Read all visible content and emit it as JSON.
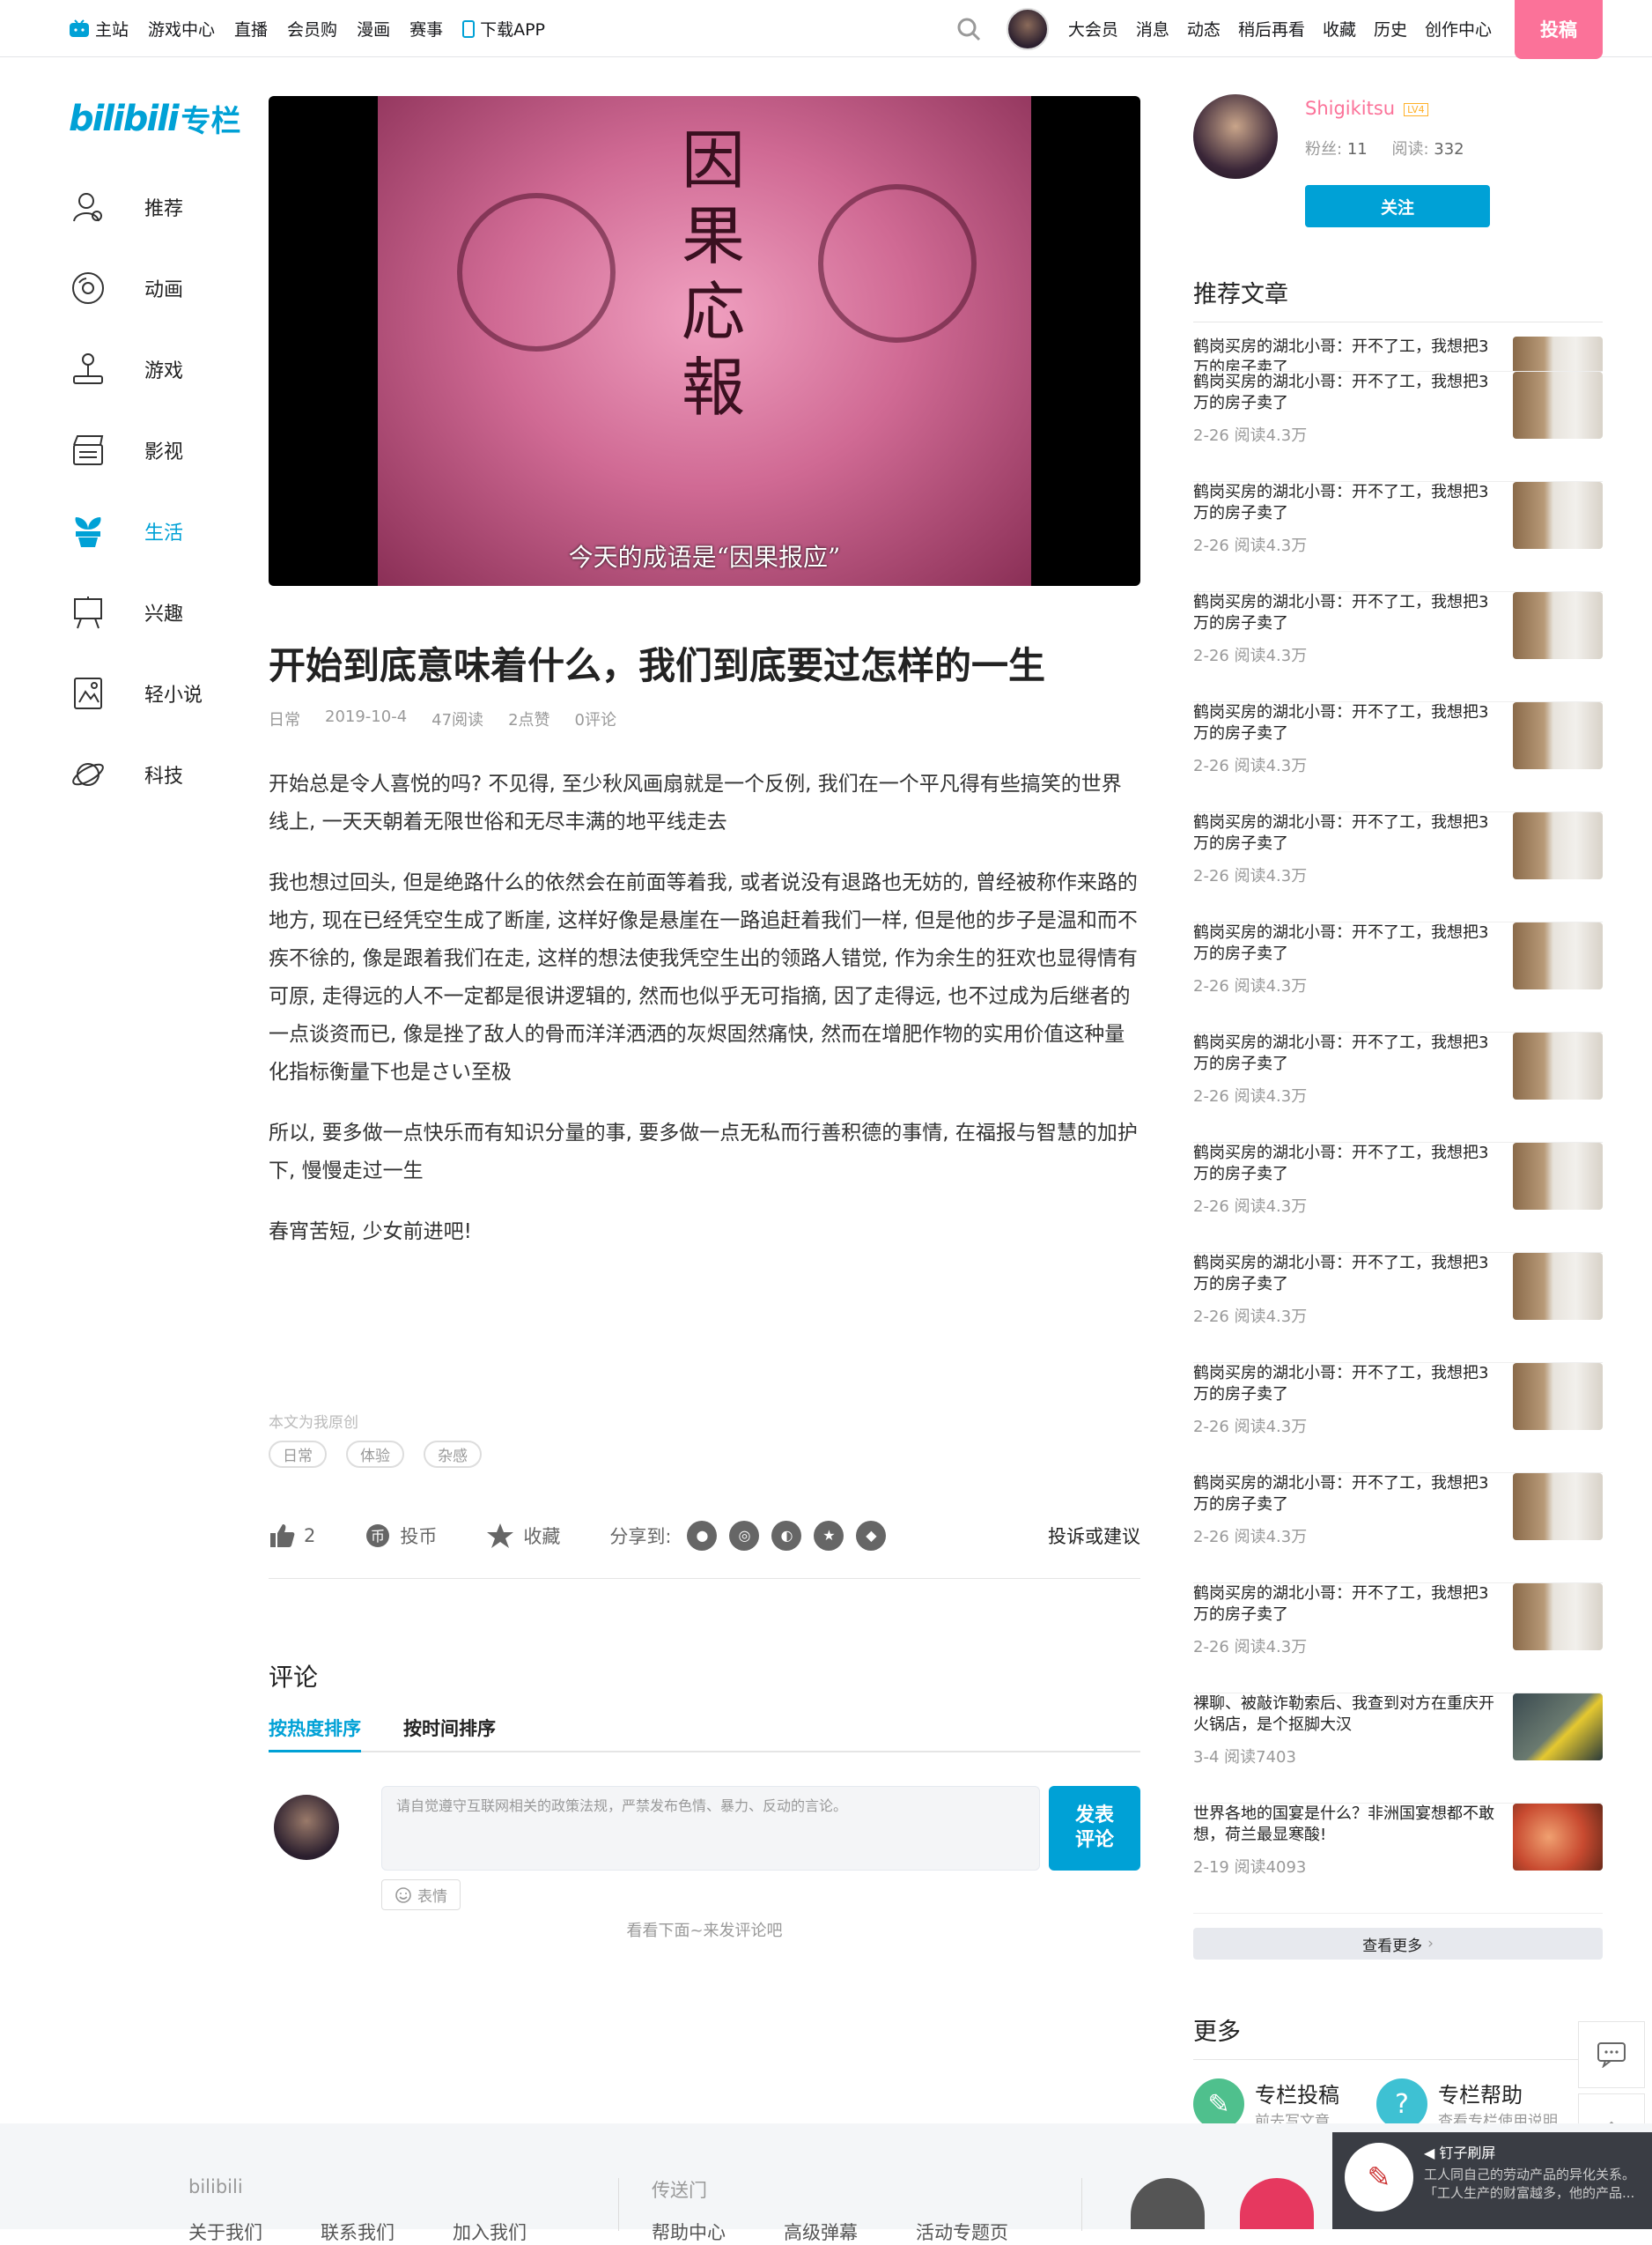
{
  "nav": {
    "left": [
      "主站",
      "游戏中心",
      "直播",
      "会员购",
      "漫画",
      "赛事",
      "下载APP"
    ],
    "right": [
      "大会员",
      "消息",
      "动态",
      "稍后再看",
      "收藏",
      "历史",
      "创作中心"
    ],
    "upload": "投稿"
  },
  "sidebar": {
    "logo_b": "bilibili",
    "logo_z": "专栏",
    "items": [
      {
        "label": "推荐",
        "icon": "user-icon"
      },
      {
        "label": "动画",
        "icon": "disc-icon"
      },
      {
        "label": "游戏",
        "icon": "joystick-icon"
      },
      {
        "label": "影视",
        "icon": "clapper-icon"
      },
      {
        "label": "生活",
        "icon": "plant-icon",
        "active": true
      },
      {
        "label": "兴趣",
        "icon": "easel-icon"
      },
      {
        "label": "轻小说",
        "icon": "book-icon"
      },
      {
        "label": "科技",
        "icon": "planet-icon"
      }
    ]
  },
  "banner": {
    "title": "因果応報",
    "subtitle": "今天的成语是“因果报应”"
  },
  "article": {
    "title": "开始到底意味着什么，我们到底要过怎样的一生",
    "meta": {
      "category": "日常",
      "date": "2019-10-4",
      "reads": "47阅读",
      "likes": "2点赞",
      "comments": "0评论"
    },
    "paragraphs": [
      "开始总是令人喜悦的吗? 不见得, 至少秋风画扇就是一个反例, 我们在一个平凡得有些搞笑的世界线上, 一天天朝着无限世俗和无尽丰满的地平线走去",
      "我也想过回头, 但是绝路什么的依然会在前面等着我, 或者说没有退路也无妨的, 曾经被称作来路的地方, 现在已经凭空生成了断崖, 这样好像是悬崖在一路追赶着我们一样, 但是他的步子是温和而不疾不徐的, 像是跟着我们在走, 这样的想法使我凭空生出的领路人错觉, 作为余生的狂欢也显得情有可原, 走得远的人不一定都是很讲逻辑的, 然而也似乎无可指摘, 因了走得远, 也不过成为后继者的一点谈资而已, 像是挫了敌人的骨而洋洋洒洒的灰烬固然痛快, 然而在增肥作物的实用价值这种量化指标衡量下也是さい至极",
      "所以, 要多做一点快乐而有知识分量的事, 要多做一点无私而行善积德的事情, 在福报与智慧的加护下, 慢慢走过一生",
      "春宵苦短, 少女前进吧!"
    ],
    "original_note": "本文为我原创",
    "tags": [
      "日常",
      "体验",
      "杂感"
    ]
  },
  "actions": {
    "like_count": "2",
    "coin": "投币",
    "fav": "收藏",
    "share_label": "分享到:",
    "report": "投诉或建议"
  },
  "comments": {
    "heading": "评论",
    "tabs": [
      "按热度排序",
      "按时间排序"
    ],
    "placeholder": "请自觉遵守互联网相关的政策法规，严禁发布色情、暴力、反动的言论。",
    "send": "发表评论",
    "emoji": "表情",
    "empty": "看看下面~来发评论吧"
  },
  "author": {
    "name": "Shigikitsu",
    "level": "LV4",
    "fans_label": "粉丝:",
    "fans": "11",
    "reads_label": "阅读:",
    "reads": "332",
    "follow": "关注"
  },
  "recommend": {
    "heading": "推荐文章",
    "items": [
      {
        "title": "鹤岗买房的湖北小哥：开不了工，我想把3万的房子卖了",
        "meta": "2-26 阅读4.3万",
        "short": true
      },
      {
        "title": "鹤岗买房的湖北小哥：开不了工，我想把3万的房子卖了",
        "meta": "2-26 阅读4.3万"
      },
      {
        "title": "鹤岗买房的湖北小哥：开不了工，我想把3万的房子卖了",
        "meta": "2-26 阅读4.3万"
      },
      {
        "title": "鹤岗买房的湖北小哥：开不了工，我想把3万的房子卖了",
        "meta": "2-26 阅读4.3万"
      },
      {
        "title": "鹤岗买房的湖北小哥：开不了工，我想把3万的房子卖了",
        "meta": "2-26 阅读4.3万"
      },
      {
        "title": "鹤岗买房的湖北小哥：开不了工，我想把3万的房子卖了",
        "meta": "2-26 阅读4.3万"
      },
      {
        "title": "鹤岗买房的湖北小哥：开不了工，我想把3万的房子卖了",
        "meta": "2-26 阅读4.3万"
      },
      {
        "title": "鹤岗买房的湖北小哥：开不了工，我想把3万的房子卖了",
        "meta": "2-26 阅读4.3万"
      },
      {
        "title": "鹤岗买房的湖北小哥：开不了工，我想把3万的房子卖了",
        "meta": "2-26 阅读4.3万"
      },
      {
        "title": "鹤岗买房的湖北小哥：开不了工，我想把3万的房子卖了",
        "meta": "2-26 阅读4.3万"
      },
      {
        "title": "鹤岗买房的湖北小哥：开不了工，我想把3万的房子卖了",
        "meta": "2-26 阅读4.3万"
      },
      {
        "title": "鹤岗买房的湖北小哥：开不了工，我想把3万的房子卖了",
        "meta": "2-26 阅读4.3万"
      },
      {
        "title": "鹤岗买房的湖北小哥：开不了工，我想把3万的房子卖了",
        "meta": "2-26 阅读4.3万"
      },
      {
        "title": "裸聊、被敲诈勒索后、我查到对方在重庆开火锅店，是个抠脚大汉",
        "meta": "3-4 阅读7403"
      },
      {
        "title": "世界各地的国宴是什么？非洲国宴想都不敢想，荷兰最显寒酸!",
        "meta": "2-19 阅读4093"
      }
    ],
    "more": "查看更多"
  },
  "more_section": {
    "heading": "更多",
    "items": [
      {
        "title": "专栏投稿",
        "sub": "前去写文章",
        "color": "#4fc08d"
      },
      {
        "title": "专栏帮助",
        "sub": "查看专栏使用说明",
        "color": "#3ec1d3"
      }
    ]
  },
  "footer": {
    "col1": "bilibili",
    "col2": "传送门",
    "row1": [
      "关于我们",
      "联系我们",
      "加入我们"
    ],
    "row2": [
      "帮助中心",
      "高级弹幕",
      "活动专题页"
    ]
  },
  "toast": {
    "title": "钉子刷屏",
    "line1": "工人同自己的劳动产品的异化关系。",
    "line2": "「工人生产的财富越多，他的产品..."
  },
  "colors": {
    "accent": "#00a1d6",
    "pink": "#fb7299"
  }
}
